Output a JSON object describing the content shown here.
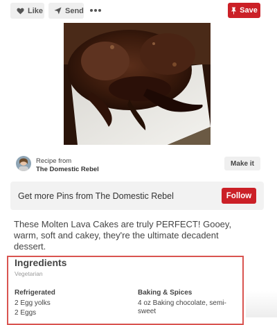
{
  "toolbar": {
    "like_label": "Like",
    "send_label": "Send",
    "more_icon": "ellipsis-icon",
    "save_label": "Save",
    "save_color": "#cb2027"
  },
  "pin": {
    "image_icon": "molten-lava-cake-photo"
  },
  "attribution": {
    "recipe_from": "Recipe from",
    "source_name": "The Domestic Rebel",
    "make_it_label": "Make it"
  },
  "more_pins": {
    "text": "Get more Pins from The Domestic Rebel",
    "follow_label": "Follow",
    "follow_color": "#cb2027"
  },
  "description": "These Molten Lava Cakes are truly PERFECT! Gooey, warm, soft and cakey, they're the ultimate decadent dessert.",
  "ingredients": {
    "title": "Ingredients",
    "subtitle": "Vegetarian",
    "highlight_color": "#d9534f",
    "sections": [
      {
        "heading": "Refrigerated",
        "items": [
          "2 Egg yolks",
          "2 Eggs"
        ]
      },
      {
        "heading": "Baking & Spices",
        "items": [
          "4 oz Baking chocolate, semi-sweet"
        ]
      }
    ]
  }
}
